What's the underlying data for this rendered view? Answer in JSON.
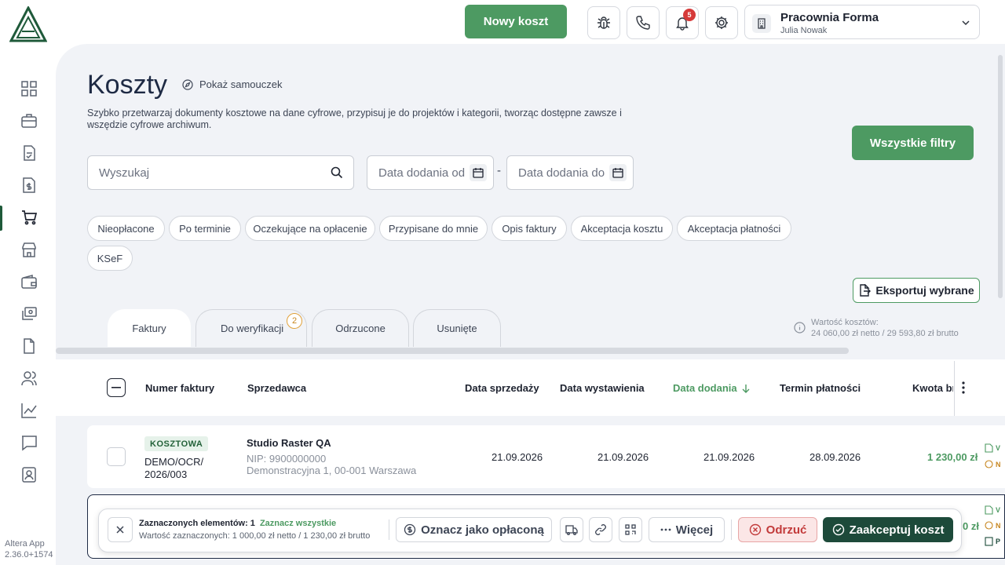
{
  "app": {
    "name": "Altera App",
    "version": "2.36.0+1574"
  },
  "topbar": {
    "new_cost_label": "Nowy koszt",
    "notifications_count": "5",
    "company_name": "Pracownia Forma",
    "user_name": "Julia Nowak"
  },
  "sidebar": {
    "items": [
      "dashboard-icon",
      "briefcase-icon",
      "document-check-icon",
      "money-document-icon",
      "cart-icon",
      "store-icon",
      "wallet-icon",
      "cash-stack-icon",
      "file-icon",
      "users-icon",
      "chart-icon",
      "chat-icon",
      "contact-icon"
    ],
    "active": "cart-icon"
  },
  "header": {
    "title": "Koszty",
    "tutorial_label": "Pokaż samouczek",
    "description": "Szybko przetwarzaj dokumenty kosztowe na dane cyfrowe, przypisuj je do projektów i kategorii, tworząc dostępne zawsze i wszędzie cyfrowe archiwum.",
    "all_filters_label": "Wszystkie filtry"
  },
  "search": {
    "placeholder": "Wyszukaj"
  },
  "date_from": {
    "placeholder": "Data dodania od"
  },
  "date_to": {
    "placeholder": "Data dodania do"
  },
  "date_separator": "-",
  "chips": [
    "Nieopłacone",
    "Po terminie",
    "Oczekujące na opłacenie",
    "Przypisane do mnie",
    "Opis faktury",
    "Akceptacja kosztu",
    "Akceptacja płatności",
    "KSeF"
  ],
  "export_label": "Eksportuj wybrane",
  "tabs": [
    {
      "label": "Faktury",
      "active": true
    },
    {
      "label": "Do weryfikacji",
      "badge": "2"
    },
    {
      "label": "Odrzucone"
    },
    {
      "label": "Usunięte"
    }
  ],
  "summary": {
    "label": "Wartość kosztów:",
    "value": "24 060,00 zł netto / 29 593,80 zł brutto"
  },
  "table": {
    "columns": [
      "Numer faktury",
      "Sprzedawca",
      "Data sprzedaży",
      "Data wystawienia",
      "Data dodania",
      "Termin płatności",
      "Kwota br"
    ],
    "rows": [
      {
        "type": "KOSZTOWA",
        "number_line1": "DEMO/OCR/",
        "number_line2": "2026/003",
        "seller": "Studio Raster QA",
        "nip": "NIP: 9900000000",
        "address": "Demonstracyjna 1, 00-001 Warszawa",
        "sale_date": "21.09.2026",
        "issue_date": "21.09.2026",
        "added_date": "21.09.2026",
        "due_date": "28.09.2026",
        "amount": "1 230,00 zł",
        "status_1": "V",
        "status_2": "N"
      },
      {
        "amount": "0 zł",
        "status_1": "V",
        "status_2": "N",
        "status_3": "P"
      }
    ]
  },
  "selection_bar": {
    "selected_label": "Zaznaczonych elementów: 1",
    "select_all_label": "Zaznacz wszystkie",
    "value_label": "Wartość zaznaczonych: 1 000,00 zł netto / 1 230,00 zł brutto",
    "mark_paid_label": "Oznacz jako opłaconą",
    "more_label": "Więcej",
    "reject_label": "Odrzuć",
    "accept_label": "Zaakceptuj koszt"
  },
  "colors": {
    "accent": "#4d9a62",
    "dark": "#1d4a3a",
    "danger": "#d63a3a"
  }
}
